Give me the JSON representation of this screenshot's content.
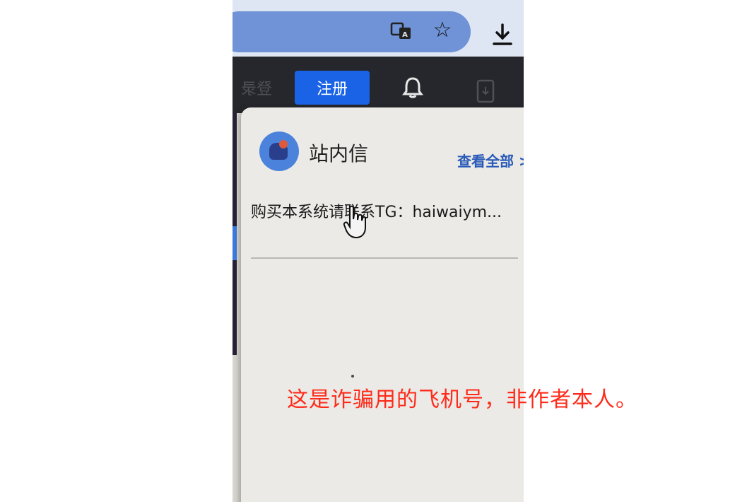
{
  "browser": {
    "translate_icon": "translate-icon",
    "bookmark_icon": "star-icon",
    "download_icon": "download-icon"
  },
  "header": {
    "login_label": "登录",
    "register_label": "注册",
    "bell_icon": "bell-icon",
    "app_icon": "download-icon"
  },
  "popup": {
    "title": "站内信",
    "view_all": "查看全部 >",
    "message": "购买本系统请联系TG：haiwaiym..."
  },
  "caption": "这是诈骗用的飞机号，非作者本人。",
  "colors": {
    "header_bg": "#25272c",
    "register_bg": "#1b63e6",
    "address_bar": "#6f93d6",
    "link": "#2a5bb8",
    "caption": "#ff2a1a"
  }
}
